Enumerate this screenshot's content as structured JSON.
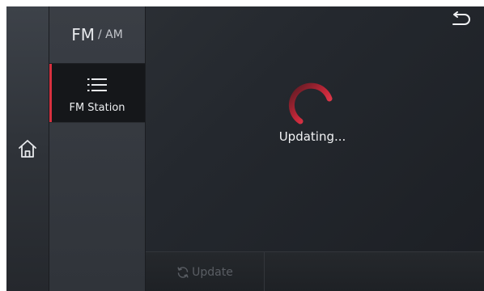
{
  "band": {
    "primary": "FM",
    "secondary": "/ AM"
  },
  "menu": {
    "items": [
      {
        "label": "FM Station",
        "icon": "list-icon",
        "selected": true
      }
    ]
  },
  "main": {
    "status": "Updating...",
    "spinner_icon": "loading-spinner-icon"
  },
  "toolbar": {
    "update_label": "Update",
    "update_icon": "refresh-icon",
    "update_enabled": false
  },
  "nav": {
    "home_icon": "home-icon",
    "back_icon": "back-arrow-icon"
  },
  "colors": {
    "accent": "#d7303f",
    "background": "#24282e",
    "text": "#f1f2f4",
    "disabled_text": "#5a5e64"
  }
}
